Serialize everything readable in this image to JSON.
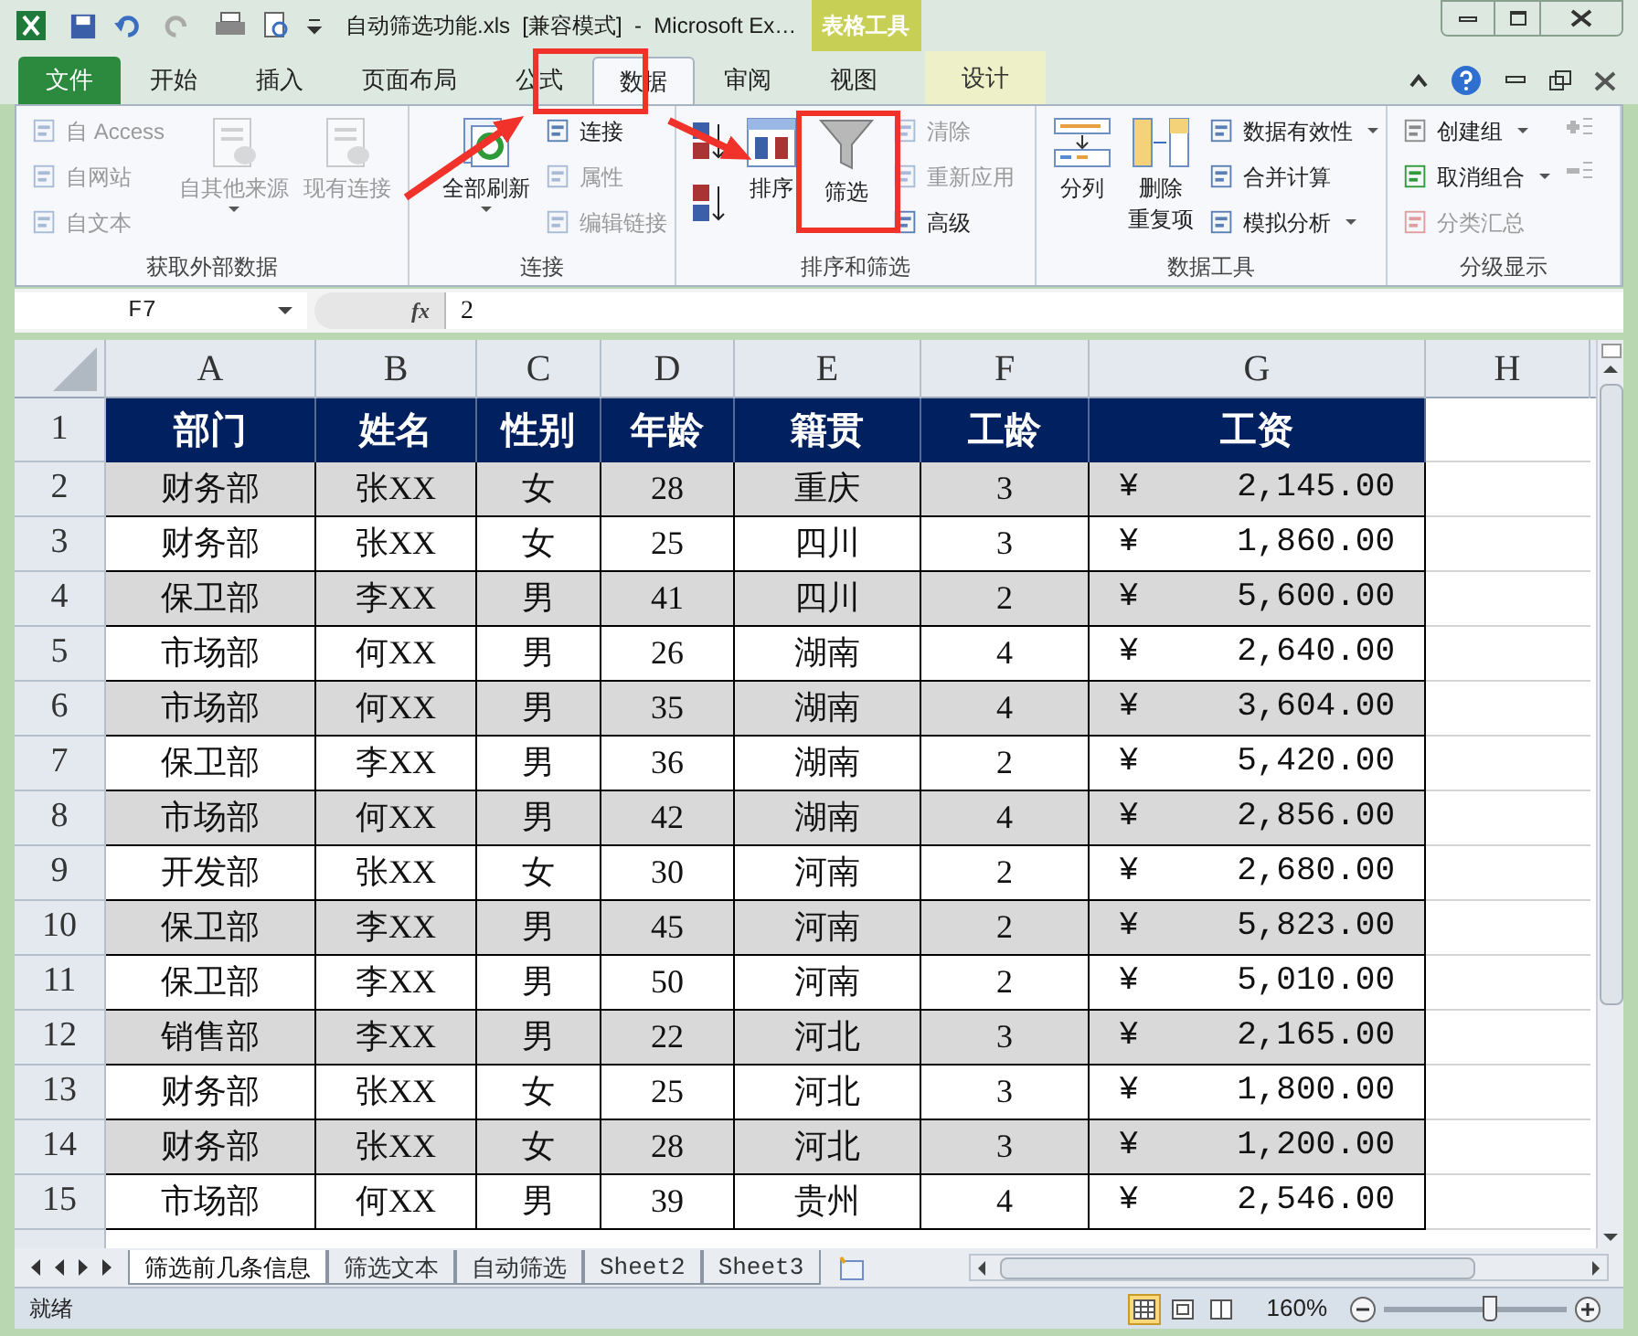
{
  "window": {
    "title": "自动筛选功能.xls  [兼容模式]  -  Microsoft Ex…",
    "context_group": "表格工具"
  },
  "ribbon_tabs": [
    {
      "label": "文件",
      "kind": "file",
      "selected": false
    },
    {
      "label": "开始",
      "kind": "tab",
      "selected": false
    },
    {
      "label": "插入",
      "kind": "tab",
      "selected": false
    },
    {
      "label": "页面布局",
      "kind": "tab",
      "selected": false
    },
    {
      "label": "公式",
      "kind": "tab",
      "selected": false
    },
    {
      "label": "数据",
      "kind": "tab",
      "selected": true
    },
    {
      "label": "审阅",
      "kind": "tab",
      "selected": false
    },
    {
      "label": "视图",
      "kind": "tab",
      "selected": false
    },
    {
      "label": "设计",
      "kind": "context",
      "selected": false
    }
  ],
  "ribbon_groups": [
    {
      "label": "获取外部数据",
      "columns": [
        {
          "kind": "stack",
          "items": [
            {
              "label": "自 Access",
              "disabled": true
            },
            {
              "label": "自网站",
              "disabled": true
            },
            {
              "label": "自文本",
              "disabled": true
            }
          ]
        },
        {
          "kind": "large",
          "label": "自其他来源",
          "disabled": true,
          "dropdown": true
        },
        {
          "kind": "large",
          "label": "现有连接",
          "disabled": true,
          "dropdown": false
        }
      ]
    },
    {
      "label": "连接",
      "columns": [
        {
          "kind": "large",
          "label": "全部刷新",
          "disabled": false,
          "dropdown": true
        },
        {
          "kind": "stack",
          "items": [
            {
              "label": "连接",
              "disabled": false
            },
            {
              "label": "属性",
              "disabled": true
            },
            {
              "label": "编辑链接",
              "disabled": true
            }
          ]
        }
      ]
    },
    {
      "label": "排序和筛选",
      "columns": [
        {
          "kind": "sort-icons"
        },
        {
          "kind": "large",
          "label": "排序",
          "disabled": false,
          "dropdown": false
        },
        {
          "kind": "large",
          "label": "筛选",
          "disabled": false,
          "dropdown": false
        },
        {
          "kind": "stack",
          "items": [
            {
              "label": "清除",
              "disabled": true
            },
            {
              "label": "重新应用",
              "disabled": true
            },
            {
              "label": "高级",
              "disabled": false
            }
          ]
        }
      ]
    },
    {
      "label": "数据工具",
      "columns": [
        {
          "kind": "large",
          "label": "分列",
          "disabled": false,
          "dropdown": false
        },
        {
          "kind": "large",
          "label": "删除",
          "sublabel": "重复项",
          "disabled": false,
          "dropdown": false
        },
        {
          "kind": "stack",
          "items": [
            {
              "label": "数据有效性",
              "disabled": false,
              "dropdown": true
            },
            {
              "label": "合并计算",
              "disabled": false
            },
            {
              "label": "模拟分析",
              "disabled": false,
              "dropdown": true
            }
          ]
        }
      ]
    },
    {
      "label": "分级显示",
      "columns": [
        {
          "kind": "stack",
          "items": [
            {
              "label": "创建组",
              "disabled": false,
              "dropdown": true
            },
            {
              "label": "取消组合",
              "disabled": false,
              "dropdown": true
            },
            {
              "label": "分类汇总",
              "disabled": true
            }
          ]
        },
        {
          "kind": "icon-column"
        }
      ]
    }
  ],
  "name_box": "F7",
  "function_button": "fx",
  "formula": "2",
  "columns": [
    "A",
    "B",
    "C",
    "D",
    "E",
    "F",
    "G",
    "H"
  ],
  "header_row": {
    "number": "1",
    "cells": [
      "部门",
      "姓名",
      "性别",
      "年龄",
      "籍贯",
      "工龄",
      "工资"
    ]
  },
  "rows": [
    {
      "number": "2",
      "shaded": true,
      "cells": [
        "财务部",
        "张XX",
        "女",
        "28",
        "重庆",
        "3"
      ],
      "currency": "¥",
      "amount": "2,145.00"
    },
    {
      "number": "3",
      "shaded": false,
      "cells": [
        "财务部",
        "张XX",
        "女",
        "25",
        "四川",
        "3"
      ],
      "currency": "¥",
      "amount": "1,860.00"
    },
    {
      "number": "4",
      "shaded": true,
      "cells": [
        "保卫部",
        "李XX",
        "男",
        "41",
        "四川",
        "2"
      ],
      "currency": "¥",
      "amount": "5,600.00"
    },
    {
      "number": "5",
      "shaded": false,
      "cells": [
        "市场部",
        "何XX",
        "男",
        "26",
        "湖南",
        "4"
      ],
      "currency": "¥",
      "amount": "2,640.00"
    },
    {
      "number": "6",
      "shaded": true,
      "cells": [
        "市场部",
        "何XX",
        "男",
        "35",
        "湖南",
        "4"
      ],
      "currency": "¥",
      "amount": "3,604.00"
    },
    {
      "number": "7",
      "shaded": false,
      "cells": [
        "保卫部",
        "李XX",
        "男",
        "36",
        "湖南",
        "2"
      ],
      "currency": "¥",
      "amount": "5,420.00"
    },
    {
      "number": "8",
      "shaded": true,
      "cells": [
        "市场部",
        "何XX",
        "男",
        "42",
        "湖南",
        "4"
      ],
      "currency": "¥",
      "amount": "2,856.00"
    },
    {
      "number": "9",
      "shaded": false,
      "cells": [
        "开发部",
        "张XX",
        "女",
        "30",
        "河南",
        "2"
      ],
      "currency": "¥",
      "amount": "2,680.00"
    },
    {
      "number": "10",
      "shaded": true,
      "cells": [
        "保卫部",
        "李XX",
        "男",
        "45",
        "河南",
        "2"
      ],
      "currency": "¥",
      "amount": "5,823.00"
    },
    {
      "number": "11",
      "shaded": false,
      "cells": [
        "保卫部",
        "李XX",
        "男",
        "50",
        "河南",
        "2"
      ],
      "currency": "¥",
      "amount": "5,010.00"
    },
    {
      "number": "12",
      "shaded": true,
      "cells": [
        "销售部",
        "李XX",
        "男",
        "22",
        "河北",
        "3"
      ],
      "currency": "¥",
      "amount": "2,165.00"
    },
    {
      "number": "13",
      "shaded": false,
      "cells": [
        "财务部",
        "张XX",
        "女",
        "25",
        "河北",
        "3"
      ],
      "currency": "¥",
      "amount": "1,800.00"
    },
    {
      "number": "14",
      "shaded": true,
      "cells": [
        "财务部",
        "张XX",
        "女",
        "28",
        "河北",
        "3"
      ],
      "currency": "¥",
      "amount": "1,200.00"
    },
    {
      "number": "15",
      "shaded": false,
      "cells": [
        "市场部",
        "何XX",
        "男",
        "39",
        "贵州",
        "4"
      ],
      "currency": "¥",
      "amount": "2,546.00"
    }
  ],
  "sheet_tabs": [
    {
      "label": "筛选前几条信息",
      "selected": true
    },
    {
      "label": "筛选文本",
      "selected": false
    },
    {
      "label": "自动筛选",
      "selected": false
    },
    {
      "label": "Sheet2",
      "selected": false
    },
    {
      "label": "Sheet3",
      "selected": false
    }
  ],
  "status_bar": {
    "text": "就绪",
    "views": [
      {
        "kind": "normal",
        "selected": true
      },
      {
        "kind": "page-layout",
        "selected": false
      },
      {
        "kind": "page-break",
        "selected": false
      }
    ],
    "zoom": "160%",
    "zoom_slider": {
      "level": 0.58
    }
  }
}
